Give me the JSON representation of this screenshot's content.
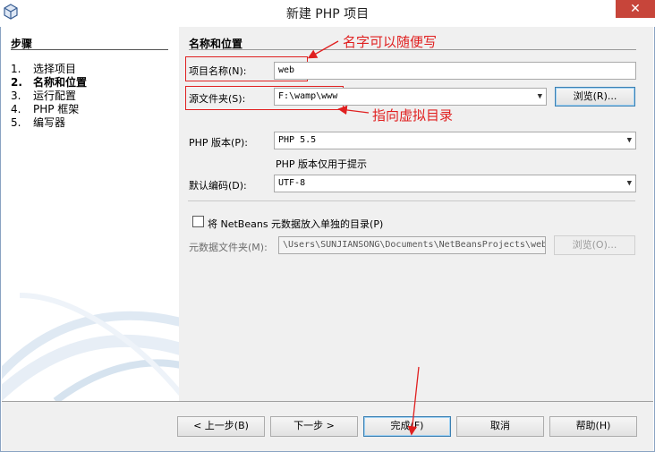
{
  "window": {
    "title": "新建 PHP 项目",
    "close_label": "✕"
  },
  "steps": {
    "title": "步骤",
    "items": [
      {
        "num": "1.",
        "label": "选择项目",
        "active": false
      },
      {
        "num": "2.",
        "label": "名称和位置",
        "active": true
      },
      {
        "num": "3.",
        "label": "运行配置",
        "active": false
      },
      {
        "num": "4.",
        "label": "PHP 框架",
        "active": false
      },
      {
        "num": "5.",
        "label": "编写器",
        "active": false
      }
    ]
  },
  "form": {
    "section_title": "名称和位置",
    "project_name_label": "项目名称(N):",
    "project_name_value": "web",
    "source_folder_label": "源文件夹(S):",
    "source_folder_value": "F:\\wamp\\www",
    "browse_label": "浏览(R)...",
    "php_version_label": "PHP 版本(P):",
    "php_version_value": "PHP 5.5",
    "php_version_hint": "PHP 版本仅用于提示",
    "encoding_label": "默认编码(D):",
    "encoding_value": "UTF-8",
    "separate_dir_label": "将 NetBeans 元数据放入单独的目录(P)",
    "separate_dir_checked": false,
    "metadata_folder_label": "元数据文件夹(M):",
    "metadata_folder_value": "\\Users\\SUNJIANSONG\\Documents\\NetBeansProjects\\web",
    "metadata_browse_label": "浏览(O)..."
  },
  "annotations": {
    "name_note": "名字可以随便写",
    "folder_note": "指向虚拟目录",
    "color": "#e02020"
  },
  "buttons": {
    "back": "< 上一步(B)",
    "next": "下一步 >",
    "finish": "完成(F)",
    "cancel": "取消",
    "help": "帮助(H)"
  }
}
